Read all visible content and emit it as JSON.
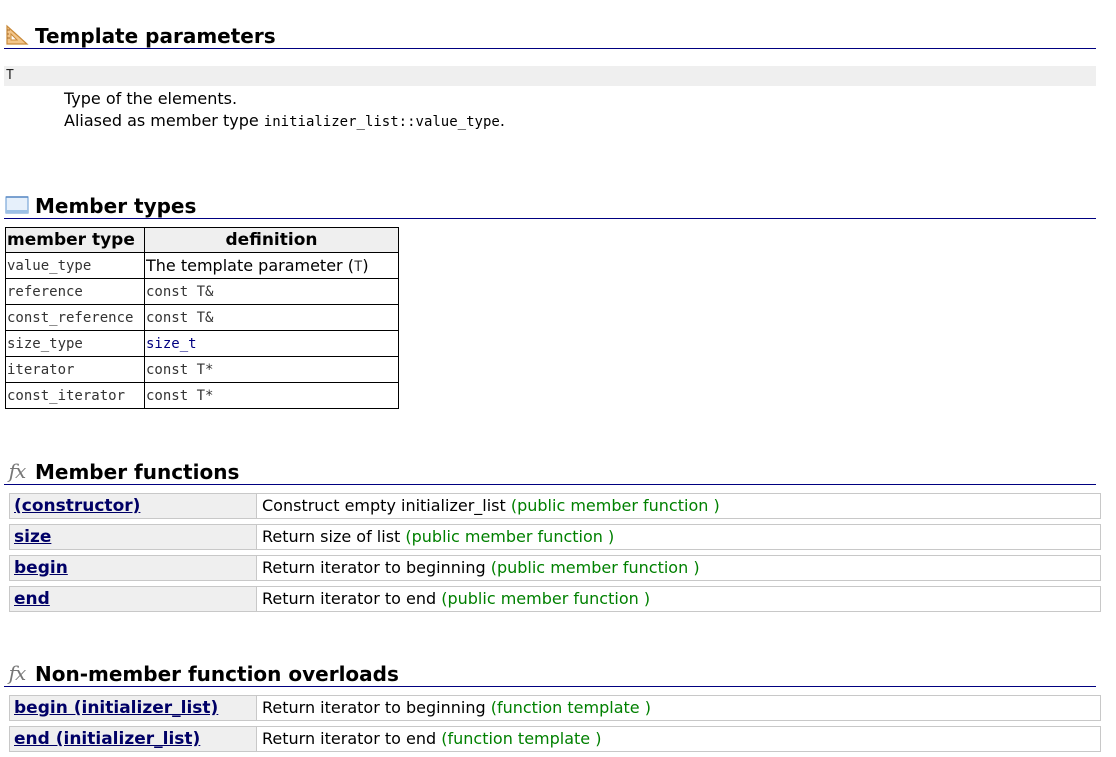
{
  "template_parameters": {
    "title": "Template parameters",
    "icon": "set-square-icon",
    "param_name": "T",
    "desc_line1": "Type of the elements.",
    "desc_line2_prefix": "Aliased as member type ",
    "desc_line2_code": "initializer_list::value_type",
    "desc_line2_suffix": "."
  },
  "member_types": {
    "title": "Member types",
    "icon": "window-icon",
    "headers": [
      "member type",
      "definition"
    ],
    "rows": [
      {
        "type": "value_type",
        "definition_prefix": "The template parameter (",
        "definition_code": "T",
        "definition_suffix": ")"
      },
      {
        "type": "reference",
        "definition": "const T&"
      },
      {
        "type": "const_reference",
        "definition": "const T&"
      },
      {
        "type": "size_type",
        "definition": "size_t"
      },
      {
        "type": "iterator",
        "definition": "const T*"
      },
      {
        "type": "const_iterator",
        "definition": "const T*"
      }
    ]
  },
  "member_functions": {
    "title": "Member functions",
    "icon": "fx-icon",
    "rows": [
      {
        "name": "(constructor)",
        "desc": "Construct empty initializer_list ",
        "kind": "(public member function )"
      },
      {
        "name": "size",
        "desc": "Return size of list ",
        "kind": "(public member function )"
      },
      {
        "name": "begin",
        "desc": "Return iterator to beginning ",
        "kind": "(public member function )"
      },
      {
        "name": "end",
        "desc": "Return iterator to end ",
        "kind": "(public member function )"
      }
    ]
  },
  "non_member_overloads": {
    "title": "Non-member function overloads",
    "icon": "fx-icon",
    "rows": [
      {
        "name": "begin (initializer_list)",
        "desc": "Return iterator to beginning ",
        "kind": "(function template )"
      },
      {
        "name": "end (initializer_list)",
        "desc": "Return iterator to end ",
        "kind": "(function template )"
      }
    ]
  },
  "colors": {
    "heading_rule": "#000080",
    "link": "#000080",
    "function_name": "#000066",
    "kind_green": "#008000",
    "cell_bg": "#efefef"
  }
}
